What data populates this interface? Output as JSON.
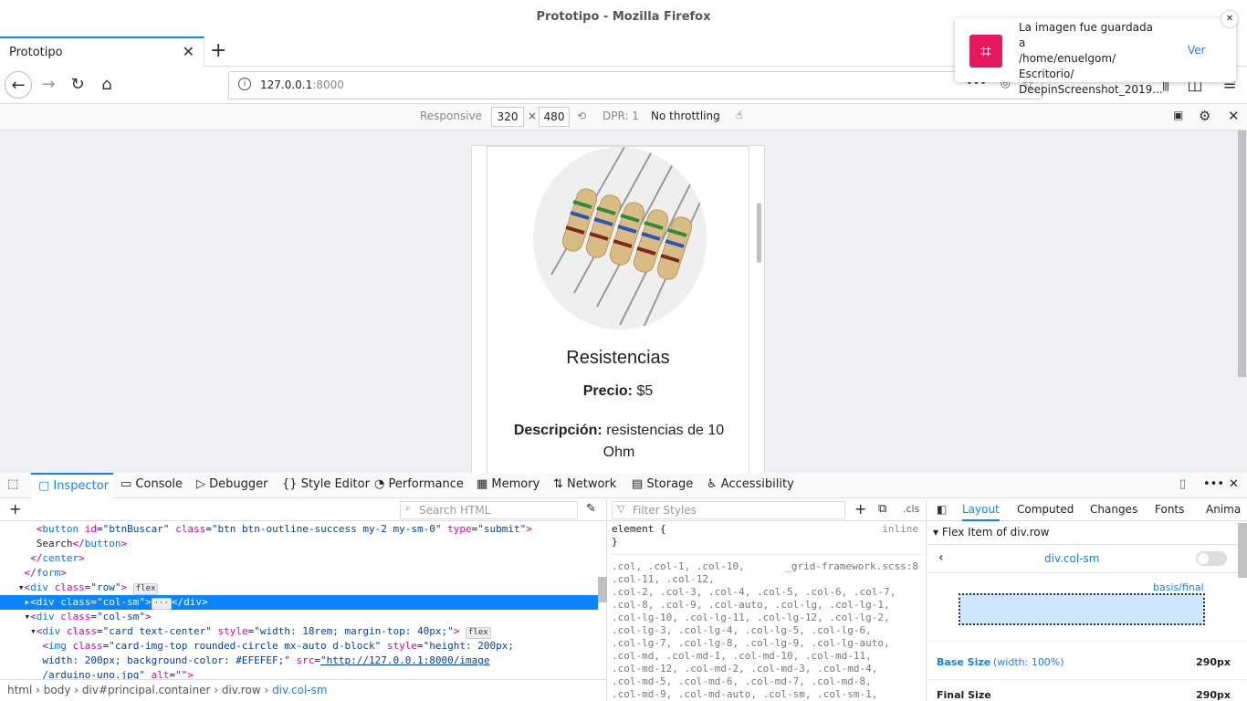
{
  "window": {
    "title": "Prototipo - Mozilla Firefox"
  },
  "tabs": [
    {
      "label": "Prototipo"
    }
  ],
  "url": {
    "host": "127.0.0.1",
    "port": ":8000"
  },
  "rdm": {
    "device": "Responsive",
    "width": "320",
    "times": "×",
    "height": "480",
    "dpr": "DPR: 1",
    "throttling": "No throttling"
  },
  "card": {
    "title": "Resistencias",
    "price_label": "Precio:",
    "price_value": "$5",
    "desc_label": "Descripción:",
    "desc_value": "resistencias de 10 Ohm"
  },
  "toast": {
    "line1": "La imagen fue guardada a",
    "line2": "/home/enuelgom/",
    "line3": "Escritorio/",
    "line4": "DeepinScreenshot_2019...",
    "action": "Ver"
  },
  "devtools": {
    "tabs": [
      "Inspector",
      "Console",
      "Debugger",
      "Style Editor",
      "Performance",
      "Memory",
      "Network",
      "Storage",
      "Accessibility"
    ],
    "search_placeholder": "Search HTML",
    "filter_placeholder": "Filter Styles",
    "cls": ".cls",
    "crumbs": [
      "html",
      "body",
      "div#principal.container",
      "div.row",
      "div.col-sm"
    ],
    "markup": [
      "    <button id=\"btnBuscar\" class=\"btn btn-outline-success my-2 my-sm-0\" type=\"submit\">",
      "    Search</button>",
      "  </center>",
      "</form>",
      "<div class=\"row\"> flex",
      "  <div class=\"col-sm\">···</div>",
      "  <div class=\"col-sm\">",
      "    <div class=\"card text-center\" style=\"width: 18rem; margin-top: 40px;\"> flex",
      "      <img class=\"card-img-top rounded-circle mx-auto d-block\" style=\"height: 200px;",
      "      width: 200px; background-color: #EFEFEF;\" src=\"http://127.0.0.1:8000/image",
      "      /arduino-uno.jpg\" alt=\"\">"
    ],
    "rules": {
      "element": "element  {",
      "inline": "inline",
      "close": "}",
      "selector": ".col, .col-1, .col-10,",
      "source": "_grid-framework.scss:8",
      "lines": [
        ".col-11, .col-12,",
        ".col-2, .col-3, .col-4, .col-5, .col-6, .col-7,",
        ".col-8, .col-9, .col-auto, .col-lg, .col-lg-1,",
        ".col-lg-10, .col-lg-11, .col-lg-12, .col-lg-2,",
        ".col-lg-3, .col-lg-4, .col-lg-5, .col-lg-6,",
        ".col-lg-7, .col-lg-8, .col-lg-9, .col-lg-auto,",
        ".col-md, .col-md-1, .col-md-10, .col-md-11,",
        ".col-md-12, .col-md-2, .col-md-3, .col-md-4,",
        ".col-md-5, .col-md-6, .col-md-7, .col-md-8,",
        ".col-md-9, .col-md-auto, .col-sm, .col-sm-1,"
      ]
    },
    "layout": {
      "tabs": [
        "Layout",
        "Computed",
        "Changes",
        "Fonts",
        "Anima"
      ],
      "section": "Flex Item of div.row",
      "item": "div.col-sm",
      "basis_final": "basis/final",
      "base_size": "Base Size",
      "base_note": "(width: 100%)",
      "base_val": "290px",
      "final_size": "Final Size",
      "final_val": "290px"
    }
  }
}
